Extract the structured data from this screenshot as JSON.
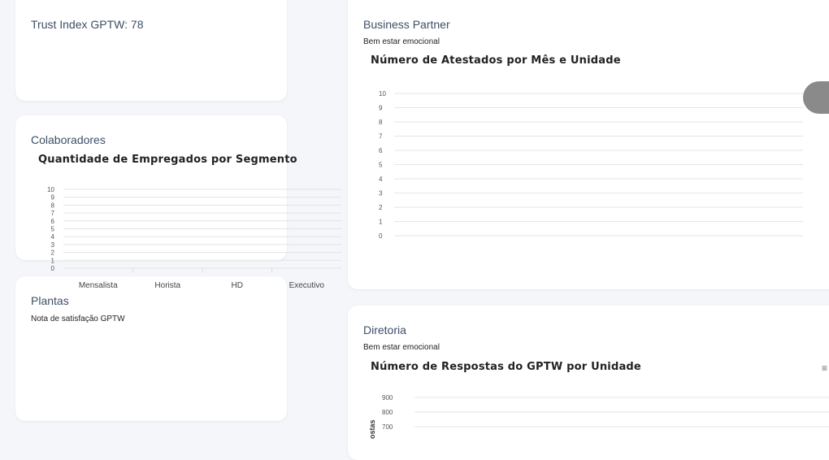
{
  "trust": {
    "title": "Trust Index GPTW: 78"
  },
  "colaboradores": {
    "title": "Colaboradores",
    "chart_title": "Quantidade de Empregados por Segmento"
  },
  "plantas": {
    "title": "Plantas",
    "subtitle": "Nota de satisfação GPTW"
  },
  "business": {
    "title": "Business Partner",
    "subtitle": "Bem estar emocional",
    "chart_title": "Número de Atestados por Mês e Unidade"
  },
  "diretoria": {
    "title": "Diretoria",
    "subtitle": "Bem estar emocional",
    "chart_title": "Número de Respostas do GPTW por Unidade",
    "menu_icon": "hamburger-menu-icon",
    "menu_glyph": "≡"
  },
  "chart_data": [
    {
      "type": "bar",
      "title": "Quantidade de Empregados por Segmento",
      "categories": [
        "Mensalista",
        "Horista",
        "HD",
        "Executivo"
      ],
      "yticks": [
        "0",
        "1",
        "2",
        "3",
        "4",
        "5",
        "6",
        "7",
        "8",
        "9",
        "10"
      ],
      "ylim": [
        0,
        10
      ],
      "values": [],
      "grid": true
    },
    {
      "type": "bar",
      "title": "Número de Atestados por Mês e Unidade",
      "yticks": [
        "0",
        "1",
        "2",
        "3",
        "4",
        "5",
        "6",
        "7",
        "8",
        "9",
        "10"
      ],
      "ylim": [
        0,
        10
      ],
      "values": [],
      "grid": true
    },
    {
      "type": "bar",
      "title": "Número de Respostas do GPTW por Unidade",
      "ylabel_visible_fragment": "ostas",
      "yticks": [
        "700",
        "800",
        "900"
      ],
      "values": [],
      "grid": true
    }
  ]
}
